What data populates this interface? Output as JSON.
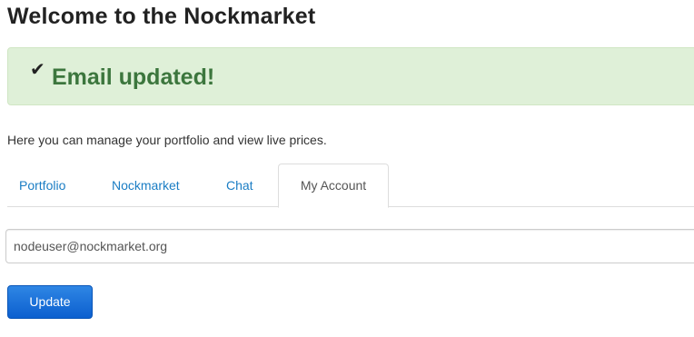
{
  "header": {
    "title": "Welcome to the Nockmarket"
  },
  "alert": {
    "icon": "check-icon",
    "icon_glyph": "✔",
    "message": "Email updated!",
    "color": "#3c763d",
    "background": "#dff0d8"
  },
  "intro": {
    "text": "Here you can manage your portfolio and view live prices."
  },
  "tabs": [
    {
      "label": "Portfolio",
      "active": false
    },
    {
      "label": "Nockmarket",
      "active": false
    },
    {
      "label": "Chat",
      "active": false
    },
    {
      "label": "My Account",
      "active": true
    }
  ],
  "account": {
    "email_value": "nodeuser@nockmarket.org",
    "update_label": "Update"
  },
  "colors": {
    "link": "#1a7dc4",
    "primary_button": "#0b5fcf"
  }
}
